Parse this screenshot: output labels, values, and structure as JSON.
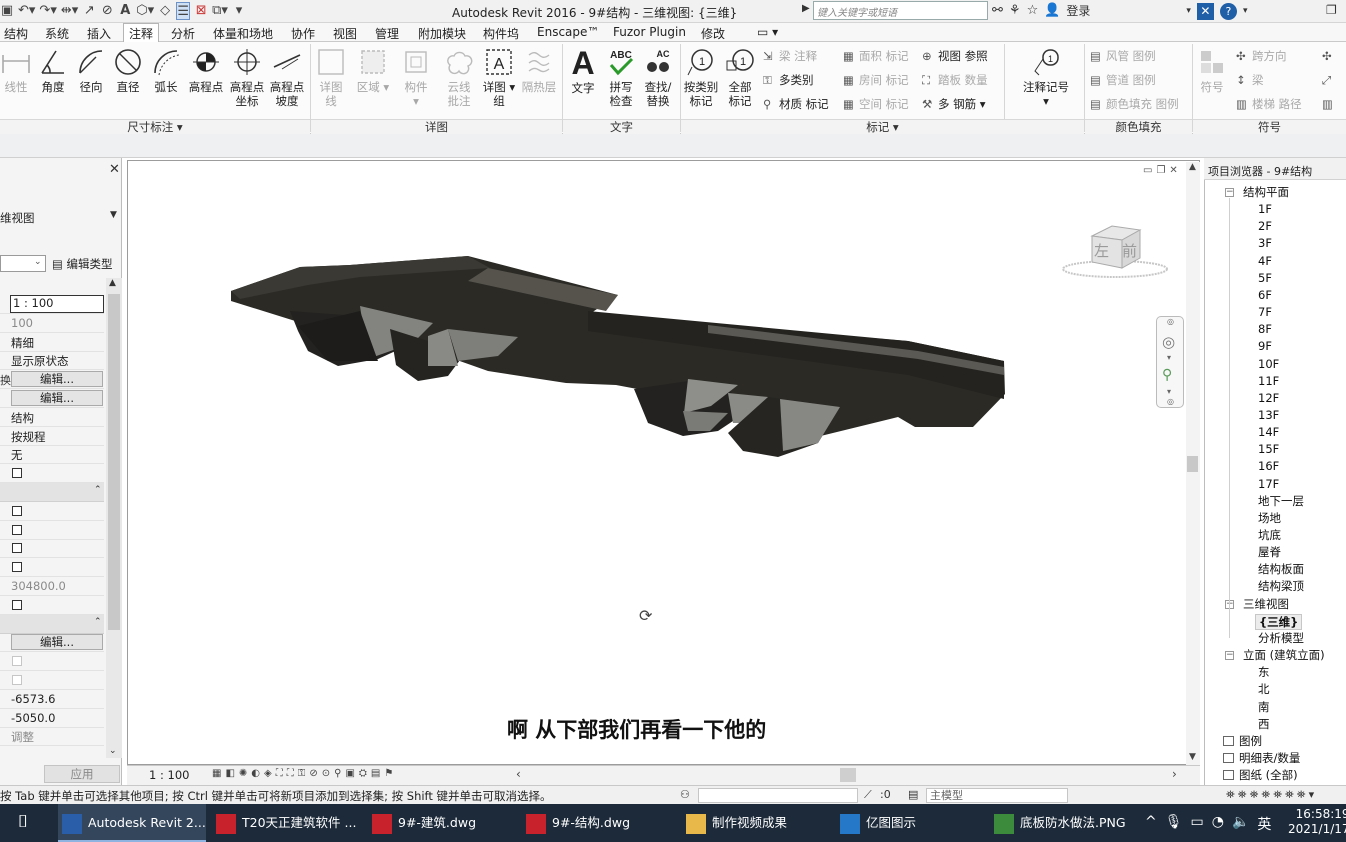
{
  "app": {
    "title": "Autodesk Revit 2016 -    9#结构 - 三维视图: {三维}",
    "search_placeholder": "键入关键字或短语",
    "login": "登录"
  },
  "menu_tabs": [
    "结构",
    "系统",
    "插入",
    "注释",
    "分析",
    "体量和场地",
    "协作",
    "视图",
    "管理",
    "附加模块",
    "构件坞",
    "Enscape™",
    "Fuzor Plugin",
    "修改"
  ],
  "active_tab": "注释",
  "ribbon": {
    "dim_tools": [
      {
        "label": "线性",
        "label2": "",
        "dim": true
      },
      {
        "label": "角度",
        "label2": ""
      },
      {
        "label": "径向",
        "label2": ""
      },
      {
        "label": "直径",
        "label2": ""
      },
      {
        "label": "弧长",
        "label2": ""
      },
      {
        "label": "高程点",
        "label2": ""
      },
      {
        "label": "高程点",
        "label2": "坐标"
      },
      {
        "label": "高程点",
        "label2": "坡度"
      }
    ],
    "detail_tools": [
      {
        "label": "详图",
        "label2": "线"
      },
      {
        "label": "区域",
        "label2": ""
      },
      {
        "label": "构件",
        "label2": ""
      },
      {
        "label": "云线",
        "label2": "批注"
      },
      {
        "label": "详图",
        "label2": "组"
      },
      {
        "label": "隔热层",
        "label2": ""
      }
    ],
    "text_tools": [
      {
        "label": "文字",
        "label2": ""
      },
      {
        "label": "拼写",
        "label2": "检查"
      },
      {
        "label": "查找/",
        "label2": "替换"
      }
    ],
    "tag_tools": [
      {
        "label": "按类别",
        "label2": "标记"
      },
      {
        "label": "全部",
        "label2": "标记"
      }
    ],
    "tag_small": [
      "梁 注释",
      "多类别",
      "材质 标记",
      "面积 标记",
      "房间 标记",
      "空间 标记",
      "视图 参照",
      "踏板 数量",
      "多 钢筋"
    ],
    "keynote": "注释记号",
    "fill_small": [
      "风管 图例",
      "管道 图例",
      "颜色填充 图例"
    ],
    "symbol_tools": [
      "符号"
    ],
    "symbol_small": [
      "跨方向",
      "梁",
      "楼梯 路径"
    ],
    "panels": [
      "尺寸标注 ▾",
      "详图",
      "文字",
      "标记 ▾",
      "颜色填充",
      "符号"
    ]
  },
  "properties": {
    "type_name": "维视图",
    "edit_type": "编辑类型",
    "rows": [
      {
        "kind": "boxed",
        "text": "1 : 100"
      },
      {
        "kind": "gray",
        "text": "100"
      },
      {
        "kind": "text",
        "text": "精细"
      },
      {
        "kind": "text",
        "text": "显示原状态"
      },
      {
        "kind": "button",
        "text": "编辑...",
        "lbl": "换"
      },
      {
        "kind": "button",
        "text": "编辑..."
      },
      {
        "kind": "text",
        "text": "结构"
      },
      {
        "kind": "text",
        "text": "按规程"
      },
      {
        "kind": "text",
        "text": "无"
      },
      {
        "kind": "check"
      },
      {
        "kind": "section"
      },
      {
        "kind": "check"
      },
      {
        "kind": "check"
      },
      {
        "kind": "check"
      },
      {
        "kind": "check"
      },
      {
        "kind": "gray",
        "text": "304800.0"
      },
      {
        "kind": "check"
      },
      {
        "kind": "section"
      },
      {
        "kind": "button",
        "text": "编辑..."
      },
      {
        "kind": "checkdim"
      },
      {
        "kind": "checkdim"
      },
      {
        "kind": "text",
        "text": "-6573.6"
      },
      {
        "kind": "text",
        "text": "-5050.0"
      },
      {
        "kind": "gray",
        "text": "调整"
      }
    ],
    "apply": "应用"
  },
  "viewcube": {
    "left": "左",
    "front": "前"
  },
  "subtitle": "啊 从下部我们再看一下他的",
  "view_scale": "1 : 100",
  "browser": {
    "title": "项目浏览器 - 9#结构",
    "plans_header": "结构平面",
    "plans": [
      "1F",
      "2F",
      "3F",
      "4F",
      "5F",
      "6F",
      "7F",
      "8F",
      "9F",
      "10F",
      "11F",
      "12F",
      "13F",
      "14F",
      "15F",
      "16F",
      "17F",
      "地下一层",
      "场地",
      "坑底",
      "屋脊",
      "结构板面",
      "结构梁顶"
    ],
    "views3d_header": "三维视图",
    "views3d": [
      "{三维}",
      "分析模型"
    ],
    "elev_header": "立面 (建筑立面)",
    "elevs": [
      "东",
      "北",
      "南",
      "西"
    ],
    "legend": "图例",
    "schedules": "明细表/数量",
    "sheets": "图纸 (全部)"
  },
  "status": {
    "hint": "按 Tab 键并单击可选择其他项目; 按 Ctrl 键并单击可将新项目添加到选择集; 按 Shift 键并单击可取消选择。",
    "zero": ":0",
    "model": "主模型"
  },
  "taskbar": {
    "items": [
      {
        "label": "Autodesk Revit 2...",
        "color": "#2b5ea8",
        "active": true
      },
      {
        "label": "T20天正建筑软件 ...",
        "color": "#c8232c"
      },
      {
        "label": "9#-建筑.dwg",
        "color": "#c8232c"
      },
      {
        "label": "9#-结构.dwg",
        "color": "#c8232c"
      },
      {
        "label": "制作视频成果",
        "color": "#e8b84a"
      },
      {
        "label": "亿图图示",
        "color": "#2577c8"
      },
      {
        "label": "底板防水做法.PNG",
        "color": "#3c8a3c"
      }
    ],
    "ime": "英",
    "time": "16:58:19",
    "date": "2021/1/17"
  }
}
